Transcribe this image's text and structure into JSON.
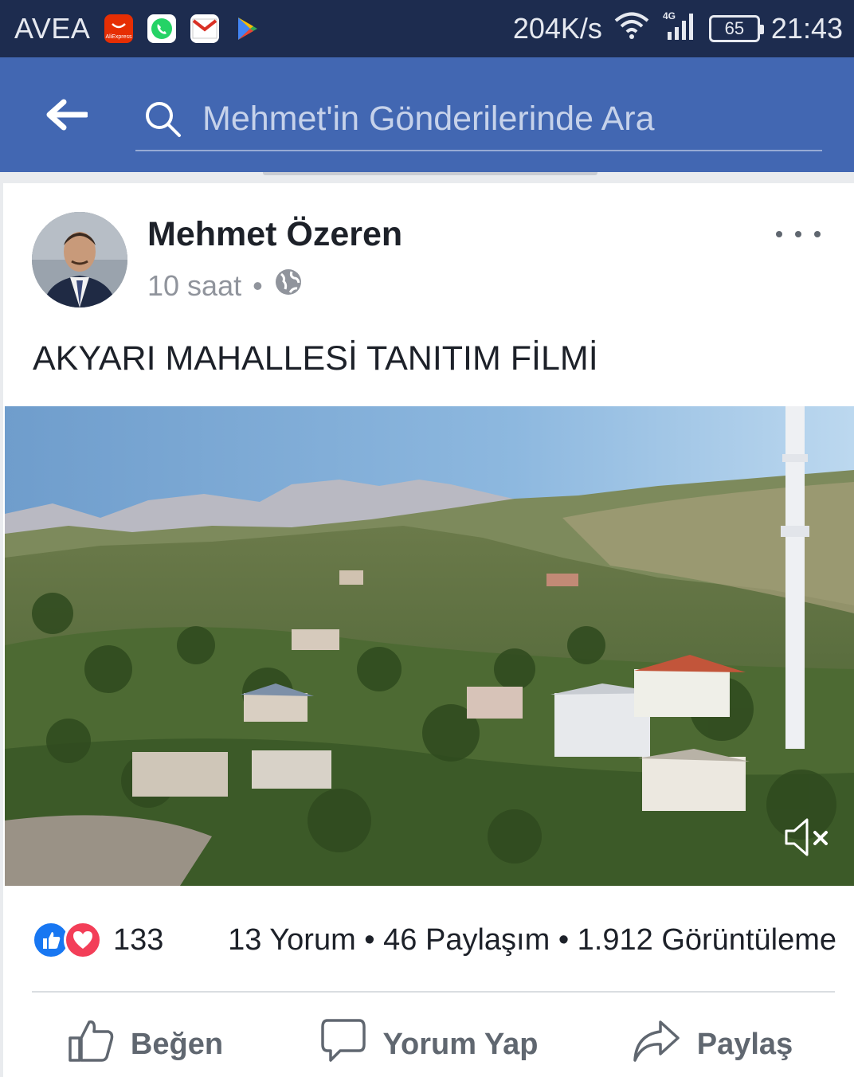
{
  "status_bar": {
    "carrier": "AVEA",
    "speed": "204K/s",
    "network": "4G",
    "battery": "65",
    "time": "21:43",
    "app_icons": [
      "aliexpress-icon",
      "whatsapp-icon",
      "gmail-icon",
      "play-store-icon"
    ],
    "aliexpress_label": "AliExpress"
  },
  "header": {
    "search_placeholder": "Mehmet'in Gönderilerinde Ara"
  },
  "post": {
    "author": "Mehmet Özeren",
    "time": "10 saat",
    "separator": "•",
    "text": "AKYARI MAHALLESİ TANITIM FİLMİ",
    "reaction_count": "133",
    "counts": "13 Yorum • 46 Paylaşım • 1.912 Görüntüleme"
  },
  "actions": {
    "like": "Beğen",
    "comment": "Yorum Yap",
    "share": "Paylaş"
  },
  "colors": {
    "header": "#4267b2",
    "status_bar": "#1d2c4f",
    "like": "#1877f2",
    "love": "#f33e58"
  }
}
